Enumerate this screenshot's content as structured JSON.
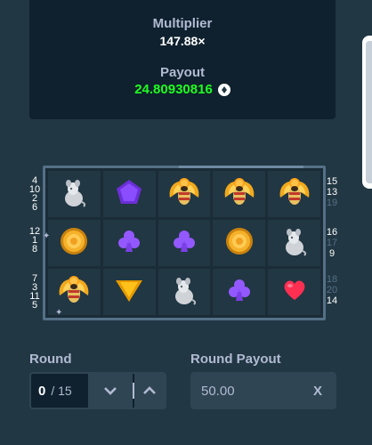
{
  "stats": {
    "multiplier_label": "Multiplier",
    "multiplier_value": "147.88×",
    "payout_label": "Payout",
    "payout_value": "24.80930816"
  },
  "left_paylines": [
    [
      "4",
      "10",
      "2",
      "6"
    ],
    [
      "12",
      "1",
      "8"
    ],
    [
      "7",
      "3",
      "11",
      "5"
    ]
  ],
  "right_paylines": [
    [
      {
        "t": "15",
        "dim": false
      },
      {
        "t": "13",
        "dim": false
      },
      {
        "t": "19",
        "dim": true
      }
    ],
    [
      {
        "t": "16",
        "dim": false
      },
      {
        "t": "17",
        "dim": true
      },
      {
        "t": "9",
        "dim": false
      }
    ],
    [
      {
        "t": "18",
        "dim": true
      },
      {
        "t": "20",
        "dim": true
      },
      {
        "t": "14",
        "dim": false
      }
    ]
  ],
  "grid": [
    [
      "rat",
      "pentagon",
      "scarab",
      "scarab",
      "scarab"
    ],
    [
      "coin",
      "club",
      "club",
      "coin",
      "rat"
    ],
    [
      "scarab",
      "triangle",
      "rat",
      "club",
      "heart"
    ]
  ],
  "round": {
    "label": "Round",
    "current": "0",
    "total": "/ 15"
  },
  "round_payout": {
    "label": "Round Payout",
    "value": "50.00",
    "clear_label": "X"
  },
  "colors": {
    "payout_green": "#1fff20",
    "panel": "#0f212e",
    "bg": "#213743"
  }
}
